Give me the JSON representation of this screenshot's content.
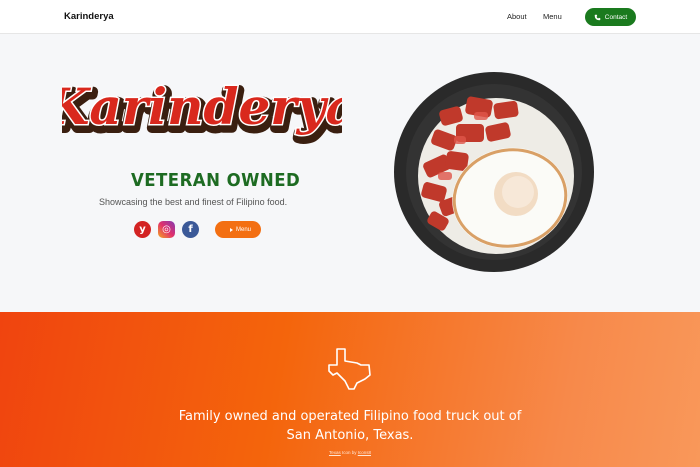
{
  "nav": {
    "brand": "Karinderya",
    "links": [
      {
        "label": "About"
      },
      {
        "label": "Menu"
      }
    ],
    "contact_label": "Contact"
  },
  "hero": {
    "logo_text": "Karinderya",
    "subtitle": "VETERAN OWNED",
    "tagline": "Showcasing the best and finest of Filipino food.",
    "social": [
      {
        "icon": "yelp-icon",
        "glyph": "y"
      },
      {
        "icon": "instagram-icon",
        "glyph": "◎"
      },
      {
        "icon": "facebook-icon",
        "glyph": "f"
      }
    ],
    "menu_button_label": "Menu"
  },
  "band": {
    "headline_line1": "Family owned and operated Filipino food truck out of",
    "headline_line2": "San Antonio, Texas.",
    "credit_prefix": "Texas",
    "credit_middle": " Icon by ",
    "credit_author": "Icons8"
  },
  "colors": {
    "brand_green": "#1a7a1e",
    "orange": "#f36f12",
    "band_start": "#f0440f",
    "band_end": "#f9985a"
  }
}
